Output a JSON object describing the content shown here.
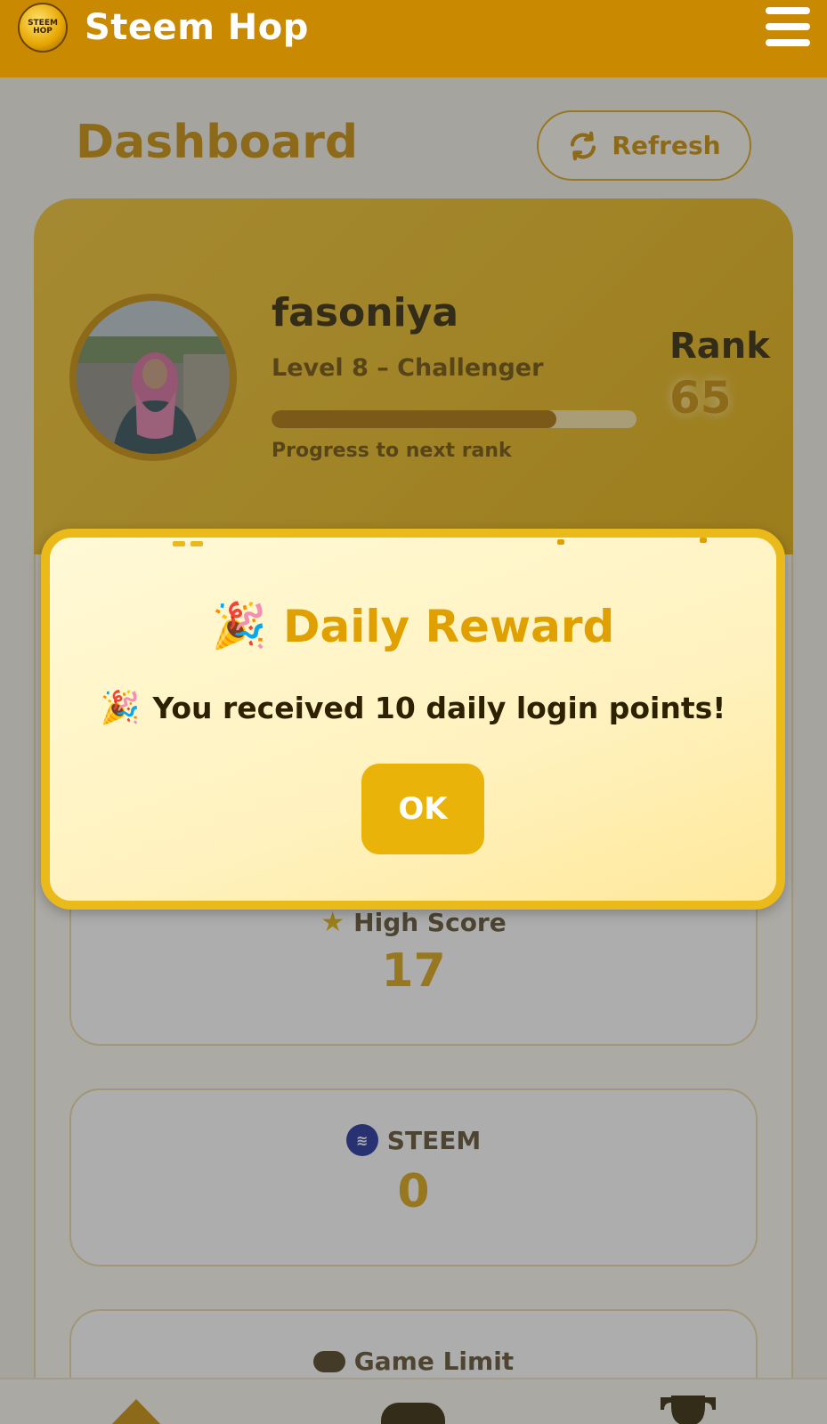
{
  "header": {
    "logo_text": "STEEM HOP",
    "app_title": "Steem Hop"
  },
  "dashboard": {
    "title": "Dashboard",
    "refresh_label": "Refresh"
  },
  "profile": {
    "username": "fasoniya",
    "level_text": "Level 8 – Challenger",
    "progress_label": "Progress to next rank",
    "progress_fraction": 0.78,
    "rank_label": "Rank",
    "rank_value": "65"
  },
  "stats": {
    "high_score_label": "High Score",
    "high_score_value": "17",
    "steem_label": "STEEM",
    "steem_value": "0",
    "game_limit_label": "Game Limit"
  },
  "modal": {
    "title": "Daily Reward",
    "title_icon": "🎉",
    "message": "You received 10 daily login points!",
    "message_icon": "🎉",
    "ok_label": "OK"
  },
  "nav": {
    "items": [
      "home-icon",
      "gamepad-icon",
      "trophy-icon"
    ]
  },
  "colors": {
    "brand": "#c98a02",
    "accent": "#eab91a",
    "steem": "#1a2b9a"
  }
}
